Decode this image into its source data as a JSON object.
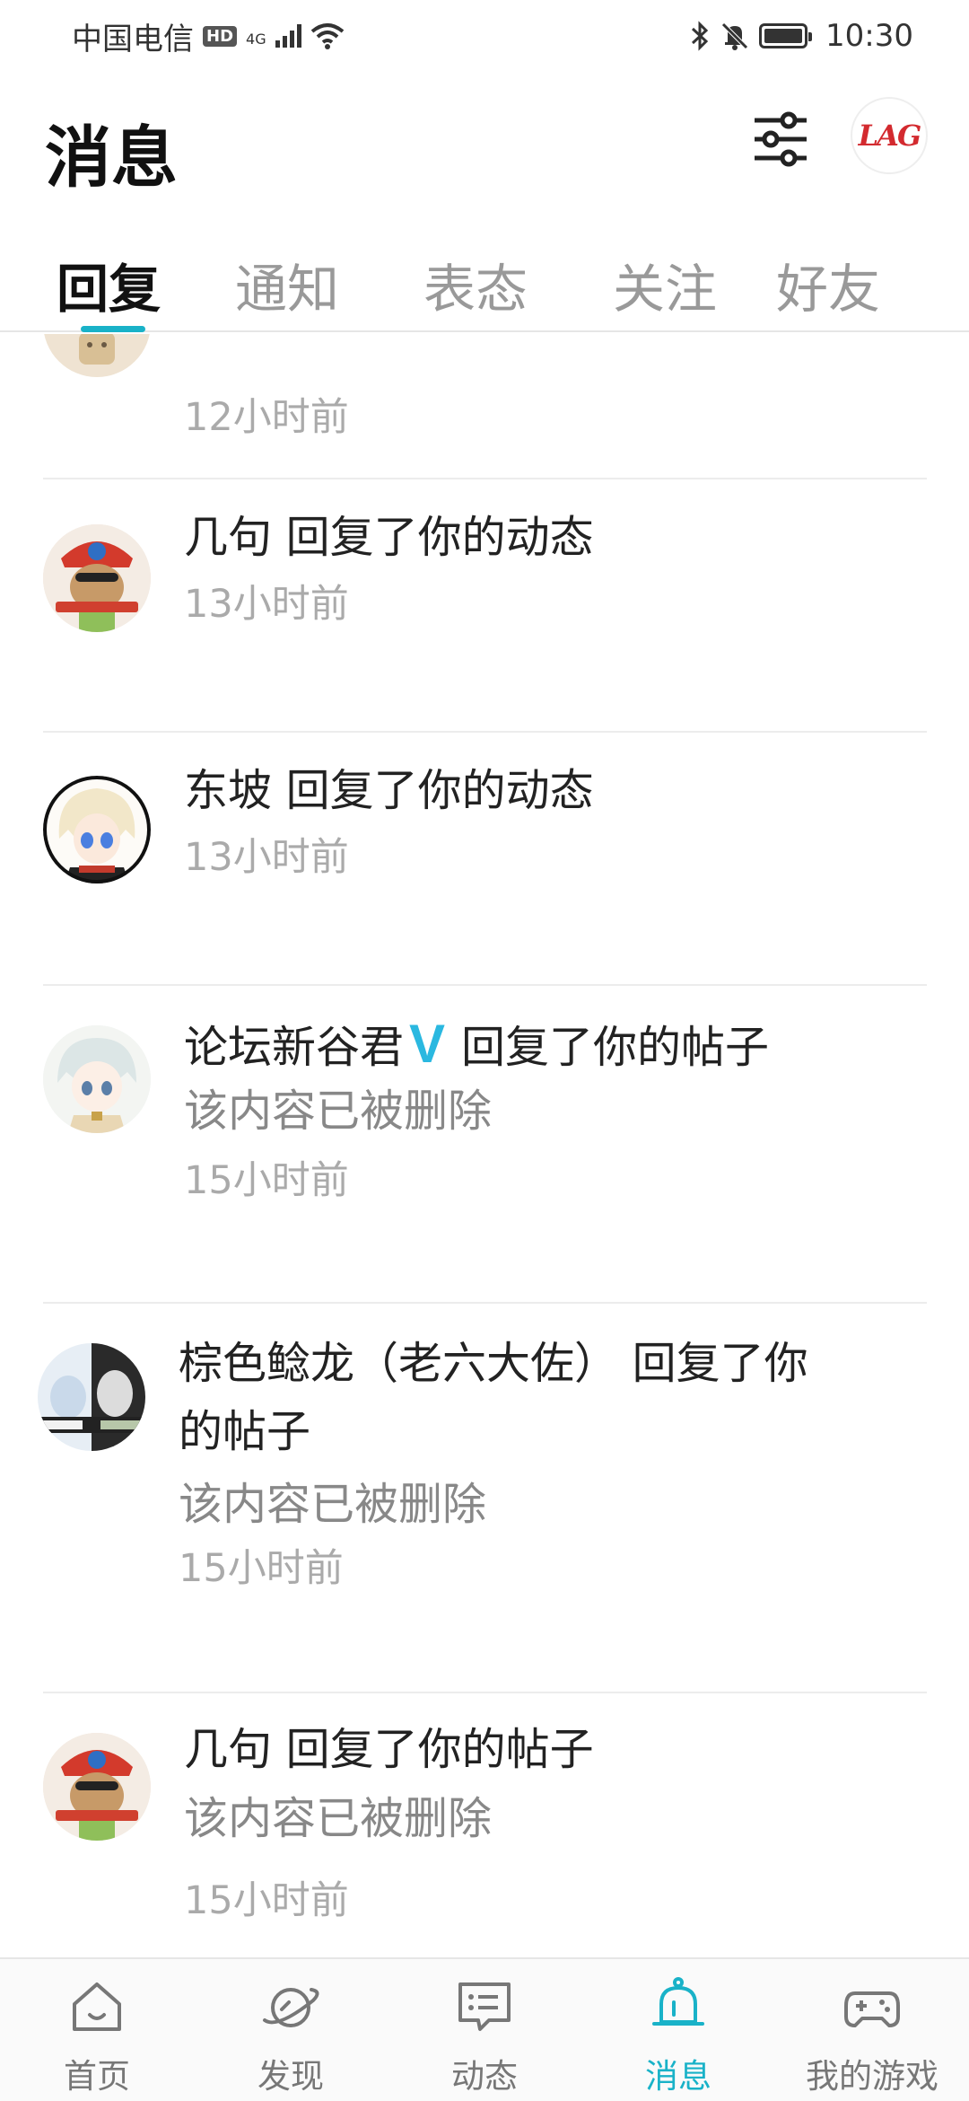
{
  "status_bar": {
    "carrier": "中国电信",
    "hd_badge": "HD",
    "network": "4G",
    "time": "10:30"
  },
  "header": {
    "title": "消息",
    "avatar_text": "LAG"
  },
  "tabs": [
    {
      "label": "回复",
      "active": true
    },
    {
      "label": "通知"
    },
    {
      "label": "表态"
    },
    {
      "label": "关注"
    },
    {
      "label": "好友"
    }
  ],
  "messages": [
    {
      "time": "12小时前"
    },
    {
      "user": "几句",
      "action": "回复了你的动态",
      "time": "13小时前"
    },
    {
      "user": "东坡",
      "action": "回复了你的动态",
      "time": "13小时前"
    },
    {
      "user": "论坛新谷君",
      "badge": "V",
      "action": "回复了你的帖子",
      "content": "该内容已被删除",
      "time": "15小时前"
    },
    {
      "line1": "棕色鲶龙（老六大佐） 回复了你",
      "line2": "的帖子",
      "content": "该内容已被删除",
      "time": "15小时前"
    },
    {
      "user": "几句",
      "action": "回复了你的帖子",
      "content": "该内容已被删除",
      "time": "15小时前"
    }
  ],
  "bottom_nav": [
    {
      "label": "首页",
      "icon": "home-icon"
    },
    {
      "label": "发现",
      "icon": "planet-icon"
    },
    {
      "label": "动态",
      "icon": "chat-icon"
    },
    {
      "label": "消息",
      "icon": "bell-icon",
      "active": true
    },
    {
      "label": "我的游戏",
      "icon": "gamepad-icon"
    }
  ],
  "colors": {
    "accent": "#19b2c8",
    "verified": "#2ab8e0",
    "avatar_text": "#d32a2f"
  }
}
